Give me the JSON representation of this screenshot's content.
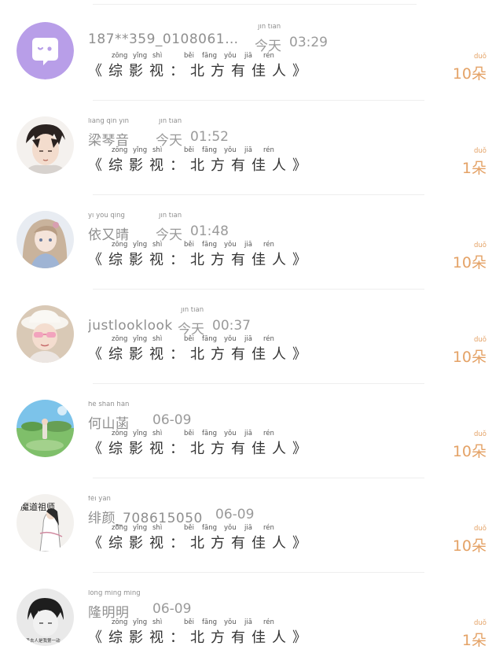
{
  "pinyin": {
    "today": "jīn tiān",
    "gift": [
      "zōng",
      "yǐng",
      "shì",
      "běi",
      "fāng",
      "yǒu",
      "jiā",
      "rén"
    ],
    "unit": "duǒ"
  },
  "gift_text": "《综影视：北方有佳人》",
  "entries": [
    {
      "name_pinyin": "",
      "name": "187**359_0108061…",
      "time_prefix": "今天",
      "time": "03:29",
      "count": "10朵"
    },
    {
      "name_pinyin": "liáng qín yīn",
      "name": "梁琴音",
      "time_prefix": "今天",
      "time": "01:52",
      "count": "1朵"
    },
    {
      "name_pinyin": "yī yòu qíng",
      "name": "依又晴",
      "time_prefix": "今天",
      "time": "01:48",
      "count": "10朵"
    },
    {
      "name_pinyin": "",
      "name": "justlooklook",
      "time_prefix": "今天",
      "time": "00:37",
      "count": "10朵"
    },
    {
      "name_pinyin": "hé shān hán",
      "name": "何山菡",
      "time_prefix": "",
      "time": "06-09",
      "count": "10朵"
    },
    {
      "name_pinyin": "fěi yán",
      "name": "绯颜_708615050",
      "time_prefix": "",
      "time": "06-09",
      "count": "10朵"
    },
    {
      "name_pinyin": "lóng míng míng",
      "name": "隆明明",
      "time_prefix": "",
      "time": "06-09",
      "count": "1朵"
    }
  ],
  "avatar_texts": {
    "e6": "魔道祖师",
    "e7": "别丢去人是我第一动"
  }
}
